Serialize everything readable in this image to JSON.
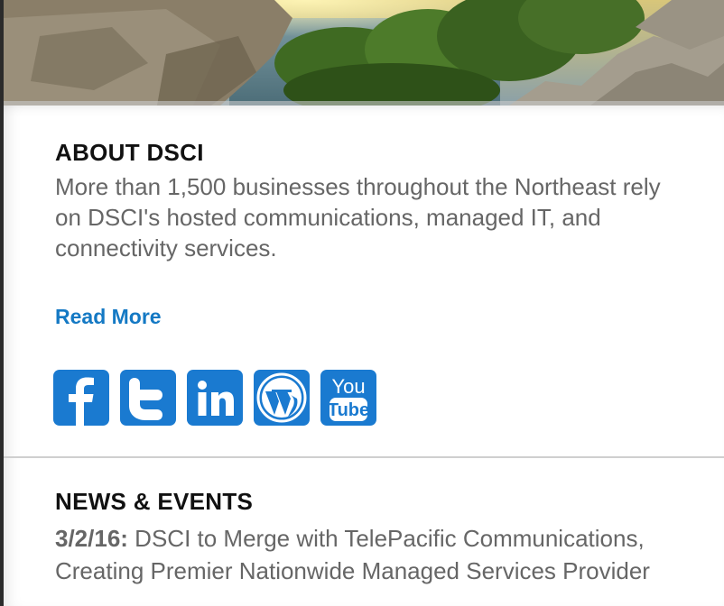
{
  "about": {
    "title": "ABOUT DSCI",
    "text": "More than 1,500 businesses throughout the Northeast rely on DSCI's hosted communications, managed IT, and connectivity services.",
    "read_more": "Read More"
  },
  "social": [
    {
      "name": "facebook",
      "icon": "facebook-icon"
    },
    {
      "name": "twitter",
      "icon": "twitter-icon"
    },
    {
      "name": "linkedin",
      "icon": "linkedin-icon"
    },
    {
      "name": "wordpress",
      "icon": "wordpress-icon"
    },
    {
      "name": "youtube",
      "icon": "youtube-icon",
      "label_top": "You",
      "label_bottom": "Tube"
    }
  ],
  "news": {
    "title": "NEWS & EVENTS",
    "items": [
      {
        "date": "3/2/16:",
        "text": " DSCI to Merge with TelePacific Communications, Creating Premier Nationwide Managed Services Provider"
      }
    ]
  },
  "colors": {
    "accent": "#1479c4",
    "social_bg": "#1a7ad0",
    "heading": "#111111",
    "body_text": "#666666"
  }
}
